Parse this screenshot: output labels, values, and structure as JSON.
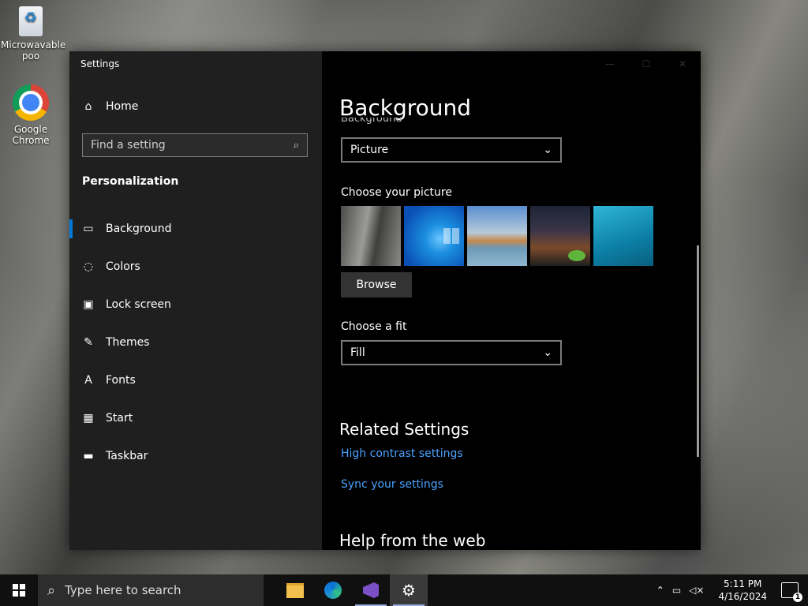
{
  "desktop": {
    "icons": [
      {
        "label": "Microwavable poo",
        "icon": "recycle-bin-icon"
      },
      {
        "label": "Google Chrome",
        "icon": "chrome-icon"
      }
    ]
  },
  "window": {
    "title": "Settings",
    "controls": {
      "minimize": "—",
      "maximize": "☐",
      "close": "✕"
    }
  },
  "sidebar": {
    "home_label": "Home",
    "search_placeholder": "Find a setting",
    "section_title": "Personalization",
    "items": [
      {
        "label": "Background",
        "icon": "picture-icon",
        "glyph": "▭",
        "active": true
      },
      {
        "label": "Colors",
        "icon": "palette-icon",
        "glyph": "◌"
      },
      {
        "label": "Lock screen",
        "icon": "lock-screen-icon",
        "glyph": "▣"
      },
      {
        "label": "Themes",
        "icon": "themes-icon",
        "glyph": "✎"
      },
      {
        "label": "Fonts",
        "icon": "fonts-icon",
        "glyph": "A"
      },
      {
        "label": "Start",
        "icon": "start-icon",
        "glyph": "▦"
      },
      {
        "label": "Taskbar",
        "icon": "taskbar-icon",
        "glyph": "▬"
      }
    ]
  },
  "main": {
    "title": "Background",
    "background_label_cut": "Background",
    "background_value": "Picture",
    "choose_picture_label": "Choose your picture",
    "browse_label": "Browse",
    "choose_fit_label": "Choose a fit",
    "fit_value": "Fill",
    "related_title": "Related Settings",
    "links": [
      "High contrast settings",
      "Sync your settings"
    ],
    "help_title": "Help from the web"
  },
  "taskbar": {
    "search_placeholder": "Type here to search",
    "time": "5:11 PM",
    "date": "4/16/2024",
    "notification_count": "1"
  },
  "colors": {
    "accent": "#0078d7",
    "link": "#4aa3ff"
  }
}
